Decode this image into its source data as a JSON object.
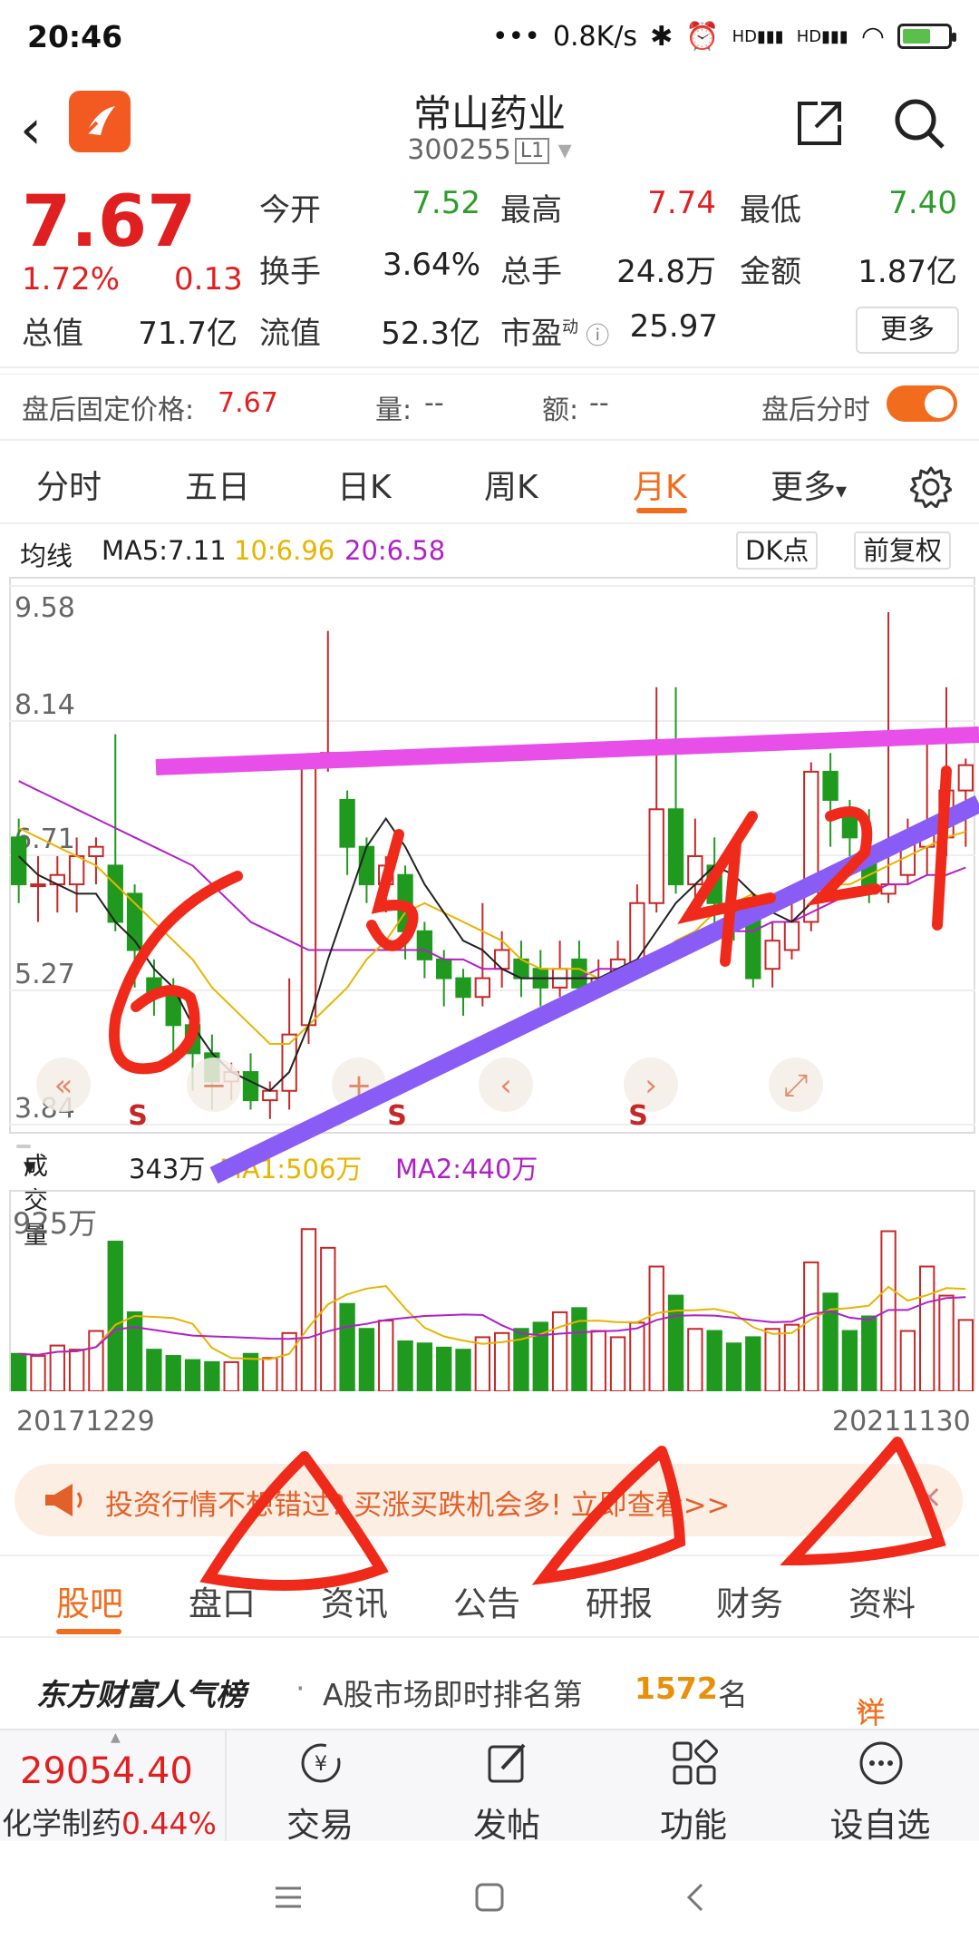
{
  "status": {
    "time": "20:46",
    "speed": "0.8K/s",
    "hd1": "HD",
    "hd2": "HD"
  },
  "header": {
    "title": "常山药业",
    "code": "300255",
    "level": "L1"
  },
  "quote": {
    "price": "7.67",
    "pct": "1.72%",
    "change": "0.13",
    "open_label": "今开",
    "open": "7.52",
    "high_label": "最高",
    "high": "7.74",
    "low_label": "最低",
    "low": "7.40",
    "turnover_label": "换手",
    "turnover": "3.64%",
    "volume_label": "总手",
    "volume": "24.8万",
    "amount_label": "金额",
    "amount": "1.87亿",
    "mcap_label": "总值",
    "mcap": "71.7亿",
    "float_label": "流值",
    "float": "52.3亿",
    "pe_label": "市盈",
    "pe_sup": "动",
    "pe": "25.97",
    "more": "更多"
  },
  "after_hours": {
    "label": "盘后固定价格:",
    "price": "7.67",
    "vol_label": "量:",
    "vol": "--",
    "amt_label": "额:",
    "amt": "--",
    "toggle_label": "盘后分时",
    "toggle_on": true
  },
  "tabs": [
    "分时",
    "五日",
    "日K",
    "周K",
    "月K",
    "更多"
  ],
  "active_tab": "月K",
  "ma": {
    "label": "均线",
    "ma5": "MA5:7.11",
    "ma10": "10:6.96",
    "ma20": "20:6.58",
    "dk": "DK点",
    "adj": "前复权"
  },
  "colors": {
    "accent": "#f26c1e",
    "up": "#e02020",
    "down": "#2c9c2c",
    "ma5": "#222222",
    "ma10": "#e8b400",
    "ma20": "#b020c8"
  },
  "chart_data": [
    {
      "type": "candlestick",
      "title": "",
      "yticks": [
        "9.58",
        "8.14",
        "6.71",
        "5.27",
        "3.84"
      ],
      "ylim": [
        3.84,
        9.58
      ],
      "x_start": "20171229",
      "x_end": "20211130",
      "candles": [
        [
          6.9,
          6.4,
          7.1,
          6.2
        ],
        [
          6.4,
          6.4,
          6.7,
          6.0
        ],
        [
          6.4,
          6.5,
          6.7,
          6.1
        ],
        [
          6.4,
          6.7,
          6.9,
          6.1
        ],
        [
          6.7,
          6.8,
          6.9,
          6.4
        ],
        [
          6.6,
          6.0,
          8.0,
          5.9
        ],
        [
          6.3,
          5.7,
          6.4,
          5.3
        ],
        [
          5.4,
          5.2,
          5.6,
          5.0
        ],
        [
          5.3,
          4.9,
          5.4,
          4.6
        ],
        [
          4.9,
          4.6,
          5.2,
          4.2
        ],
        [
          4.6,
          4.3,
          4.8,
          4.0
        ],
        [
          4.3,
          4.4,
          4.5,
          4.1
        ],
        [
          4.4,
          4.1,
          4.6,
          4.0
        ],
        [
          4.1,
          4.2,
          4.3,
          3.9
        ],
        [
          4.2,
          4.8,
          5.4,
          4.0
        ],
        [
          4.9,
          7.7,
          7.8,
          4.7
        ],
        [
          7.7,
          7.8,
          9.1,
          7.6
        ],
        [
          7.3,
          6.8,
          7.4,
          6.5
        ],
        [
          6.8,
          6.4,
          6.9,
          6.2
        ],
        [
          6.4,
          6.6,
          6.7,
          6.1
        ],
        [
          6.5,
          5.9,
          6.6,
          5.6
        ],
        [
          5.9,
          5.6,
          6.0,
          5.4
        ],
        [
          5.6,
          5.4,
          5.7,
          5.1
        ],
        [
          5.4,
          5.2,
          5.5,
          5.0
        ],
        [
          5.2,
          5.4,
          6.2,
          5.1
        ],
        [
          5.5,
          5.7,
          5.9,
          5.3
        ],
        [
          5.6,
          5.4,
          5.8,
          5.2
        ],
        [
          5.5,
          5.3,
          5.7,
          5.1
        ],
        [
          5.3,
          5.5,
          5.8,
          5.2
        ],
        [
          5.6,
          5.3,
          5.8,
          5.1
        ],
        [
          5.3,
          5.4,
          5.6,
          5.2
        ],
        [
          5.4,
          5.6,
          5.8,
          5.3
        ],
        [
          5.5,
          6.2,
          6.4,
          5.4
        ],
        [
          6.2,
          7.2,
          8.5,
          6.1
        ],
        [
          7.2,
          6.4,
          8.5,
          6.3
        ],
        [
          6.4,
          6.7,
          7.1,
          6.2
        ],
        [
          6.6,
          6.2,
          6.9,
          5.8
        ],
        [
          6.2,
          6.1,
          6.4,
          5.8
        ],
        [
          6.1,
          5.4,
          6.3,
          5.3
        ],
        [
          5.5,
          5.8,
          6.0,
          5.3
        ],
        [
          5.7,
          6.0,
          6.2,
          5.6
        ],
        [
          6.0,
          7.6,
          7.7,
          5.9
        ],
        [
          7.6,
          7.3,
          7.8,
          6.8
        ],
        [
          7.2,
          6.9,
          7.3,
          6.7
        ],
        [
          6.8,
          6.3,
          7.2,
          6.2
        ],
        [
          6.3,
          6.4,
          9.3,
          6.2
        ],
        [
          6.5,
          6.9,
          7.1,
          6.4
        ],
        [
          6.8,
          7.0,
          8.0,
          6.5
        ],
        [
          6.9,
          7.4,
          8.5,
          6.7
        ],
        [
          7.4,
          7.67,
          7.74,
          6.8
        ]
      ],
      "ma5": [
        6.7,
        6.5,
        6.4,
        6.3,
        6.3,
        6.0,
        5.8,
        5.5,
        5.3,
        4.9,
        4.6,
        4.4,
        4.3,
        4.2,
        4.4,
        4.9,
        5.6,
        6.2,
        6.8,
        7.1,
        6.8,
        6.4,
        6.1,
        5.8,
        5.7,
        5.5,
        5.4,
        5.4,
        5.4,
        5.4,
        5.4,
        5.5,
        5.6,
        5.9,
        6.2,
        6.4,
        6.6,
        6.5,
        6.3,
        6.1,
        6.0,
        6.2,
        6.4,
        6.6,
        6.7,
        6.7,
        6.8,
        6.9,
        7.0,
        7.11
      ],
      "ma10": [
        7.0,
        6.9,
        6.8,
        6.7,
        6.6,
        6.4,
        6.2,
        6.0,
        5.8,
        5.6,
        5.3,
        5.1,
        4.9,
        4.7,
        4.7,
        4.9,
        5.1,
        5.3,
        5.6,
        5.8,
        6.1,
        6.2,
        6.1,
        6.0,
        5.9,
        5.8,
        5.6,
        5.5,
        5.5,
        5.5,
        5.4,
        5.4,
        5.5,
        5.6,
        5.8,
        5.9,
        6.1,
        6.2,
        6.3,
        6.2,
        6.2,
        6.3,
        6.4,
        6.4,
        6.5,
        6.6,
        6.7,
        6.8,
        6.9,
        6.96
      ],
      "ma20": [
        7.5,
        7.4,
        7.3,
        7.2,
        7.1,
        7.0,
        6.9,
        6.8,
        6.7,
        6.6,
        6.4,
        6.2,
        6.0,
        5.9,
        5.8,
        5.7,
        5.7,
        5.7,
        5.7,
        5.7,
        5.7,
        5.7,
        5.6,
        5.6,
        5.5,
        5.5,
        5.4,
        5.4,
        5.4,
        5.4,
        5.5,
        5.5,
        5.6,
        5.6,
        5.7,
        5.8,
        5.8,
        5.9,
        5.9,
        6.0,
        6.0,
        6.1,
        6.2,
        6.3,
        6.3,
        6.4,
        6.4,
        6.5,
        6.5,
        6.58
      ],
      "sell_marks": [
        "S",
        "S",
        "S"
      ]
    },
    {
      "type": "bar",
      "title": "",
      "ylabel": "925万",
      "legend": {
        "selector": "成交量",
        "current": "343万",
        "ma1": "MA1:506万",
        "ma2": "MA2:440万"
      },
      "values": [
        180,
        170,
        220,
        200,
        290,
        720,
        380,
        200,
        170,
        150,
        140,
        140,
        180,
        160,
        280,
        780,
        690,
        420,
        300,
        340,
        240,
        230,
        210,
        200,
        260,
        280,
        300,
        330,
        380,
        400,
        290,
        260,
        330,
        600,
        460,
        300,
        290,
        230,
        260,
        300,
        320,
        620,
        470,
        290,
        360,
        770,
        290,
        600,
        460,
        343
      ]
    }
  ],
  "banner": {
    "text": "投资行情不想错过? 买涨买跌机会多! 立即查看>>",
    "close": "×"
  },
  "bottom_tabs": [
    "股吧",
    "盘口",
    "资讯",
    "公告",
    "研报",
    "财务",
    "资料"
  ],
  "active_bottom_tab": "股吧",
  "rank": {
    "brand": "东方财富人气榜",
    "dot": "·",
    "text": "A股市场即时排名第",
    "num": "1572",
    "unit": "名",
    "detail": "详情"
  },
  "index": {
    "value": "29054.40",
    "name": "化学制药",
    "pct": "0.44%"
  },
  "bottom_nav": [
    {
      "label": "交易",
      "icon": "trade-icon"
    },
    {
      "label": "发帖",
      "icon": "post-icon"
    },
    {
      "label": "功能",
      "icon": "apps-icon"
    },
    {
      "label": "设自选",
      "icon": "more-icon"
    }
  ],
  "hand_annotations": [
    "6",
    "5",
    "4",
    "2",
    "1"
  ]
}
